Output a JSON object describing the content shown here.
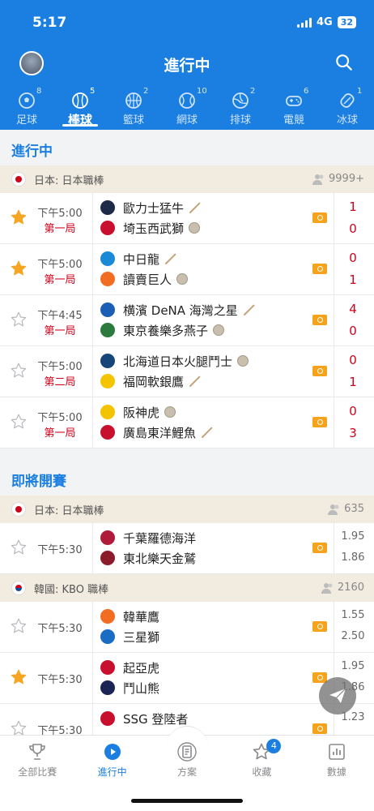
{
  "status": {
    "time": "5:17",
    "network": "4G",
    "battery": "32"
  },
  "header": {
    "title": "進行中",
    "avatar_icon": "avatar",
    "search_icon": "search-icon"
  },
  "tabs": [
    {
      "label": "足球",
      "count": "8",
      "icon": "soccer-icon"
    },
    {
      "label": "棒球",
      "count": "5",
      "icon": "baseball-icon",
      "active": true
    },
    {
      "label": "籃球",
      "count": "2",
      "icon": "basketball-icon"
    },
    {
      "label": "網球",
      "count": "10",
      "icon": "tennis-icon"
    },
    {
      "label": "排球",
      "count": "2",
      "icon": "volleyball-icon"
    },
    {
      "label": "電競",
      "count": "6",
      "icon": "gamepad-icon"
    },
    {
      "label": "冰球",
      "count": "1",
      "icon": "hockey-icon"
    }
  ],
  "live_section": {
    "title": "進行中",
    "league": {
      "name": "日本: 日本職棒",
      "count": "9999+"
    },
    "matches": [
      {
        "starred": true,
        "time": "下午5:00",
        "inning": "第一局",
        "team1": "歐力士猛牛",
        "team2": "埼玉西武獅",
        "score1": "1",
        "score2": "0",
        "t1_icon": "bat-icon",
        "t2_icon": "ball-icon",
        "logo1": "#1d2a48",
        "logo2": "#c8102e"
      },
      {
        "starred": true,
        "time": "下午5:00",
        "inning": "第一局",
        "team1": "中日龍",
        "team2": "讀賣巨人",
        "score1": "0",
        "score2": "1",
        "t1_icon": "bat-icon",
        "t2_icon": "ball-icon",
        "logo1": "#1a8ad6",
        "logo2": "#f26d21"
      },
      {
        "starred": false,
        "time": "下午4:45",
        "inning": "第一局",
        "team1": "横濱 DeNA 海灣之星",
        "team2": "東京養樂多燕子",
        "score1": "4",
        "score2": "0",
        "t1_icon": "bat-icon",
        "t2_icon": "ball-icon",
        "logo1": "#1a5fb4",
        "logo2": "#2c7a3d"
      },
      {
        "starred": false,
        "time": "下午5:00",
        "inning": "第二局",
        "team1": "北海道日本火腿鬥士",
        "team2": "福岡軟銀鷹",
        "score1": "0",
        "score2": "1",
        "t1_icon": "ball-icon",
        "t2_icon": "bat-icon",
        "logo1": "#16457a",
        "logo2": "#f4c400"
      },
      {
        "starred": false,
        "time": "下午5:00",
        "inning": "第一局",
        "team1": "阪神虎",
        "team2": "廣島東洋鯉魚",
        "score1": "0",
        "score2": "3",
        "t1_icon": "ball-icon",
        "t2_icon": "bat-icon",
        "logo1": "#f3c300",
        "logo2": "#c8102e"
      }
    ]
  },
  "upcoming_section": {
    "title": "即將開賽",
    "leagues": [
      {
        "name": "日本: 日本職棒",
        "count": "635",
        "flag": "jp",
        "matches": [
          {
            "starred": false,
            "time": "下午5:30",
            "team1": "千葉羅德海洋",
            "team2": "東北樂天金鷲",
            "odds1": "1.95",
            "odds2": "1.86",
            "logo1": "#b11b3a",
            "logo2": "#8c1c2c"
          }
        ]
      },
      {
        "name": "韓國: KBO 職棒",
        "count": "2160",
        "flag": "kr",
        "matches": [
          {
            "starred": false,
            "time": "下午5:30",
            "team1": "韓華鷹",
            "team2": "三星獅",
            "odds1": "1.55",
            "odds2": "2.50",
            "logo1": "#f26c21",
            "logo2": "#1a6dc2"
          },
          {
            "starred": true,
            "time": "下午5:30",
            "team1": "起亞虎",
            "team2": "鬥山熊",
            "odds1": "1.95",
            "odds2": "1.86",
            "logo1": "#c8102e",
            "logo2": "#1b2555"
          },
          {
            "starred": false,
            "time": "下午5:30",
            "team1": "SSG 登陸者",
            "team2": "",
            "odds1": "1.23",
            "odds2": "",
            "logo1": "#c8102e",
            "logo2": "#999999"
          }
        ]
      }
    ]
  },
  "bottom_nav": [
    {
      "label": "全部比賽",
      "icon": "trophy-icon"
    },
    {
      "label": "進行中",
      "icon": "play-icon",
      "active": true
    },
    {
      "label": "方案",
      "icon": "document-icon"
    },
    {
      "label": "收藏",
      "icon": "star-icon",
      "badge": "4"
    },
    {
      "label": "數據",
      "icon": "chart-icon"
    }
  ],
  "colors": {
    "primary": "#1a7fe0",
    "live": "#d0021b",
    "star": "#f5a623",
    "live_icon": "#f7a21b"
  }
}
